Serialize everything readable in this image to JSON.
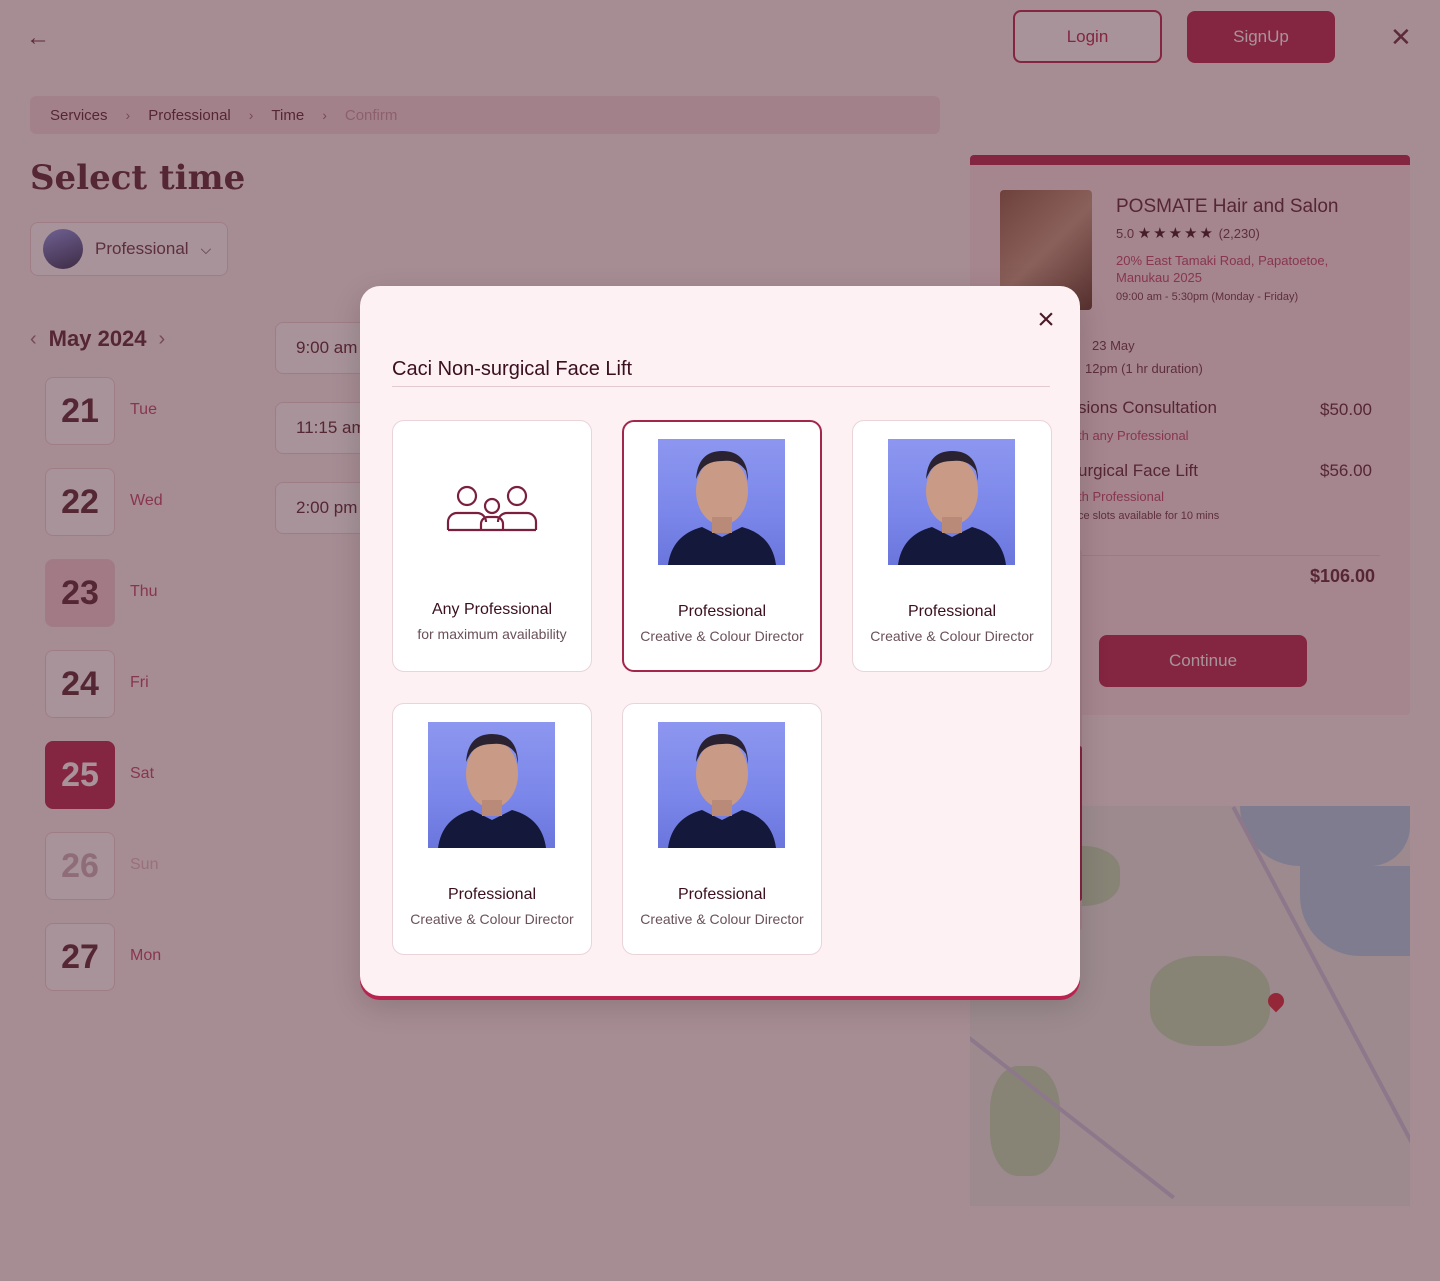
{
  "header": {
    "login_label": "Login",
    "signup_label": "SignUp"
  },
  "breadcrumb": [
    "Services",
    "Professional",
    "Time",
    "Confirm"
  ],
  "page_title": "Select time",
  "professional_select": {
    "label": "Professional"
  },
  "calendar": {
    "month": "May 2024",
    "days": [
      {
        "num": "21",
        "name": "Tue"
      },
      {
        "num": "22",
        "name": "Wed"
      },
      {
        "num": "23",
        "name": "Thu"
      },
      {
        "num": "24",
        "name": "Fri"
      },
      {
        "num": "25",
        "name": "Sat"
      },
      {
        "num": "26",
        "name": "Sun"
      },
      {
        "num": "27",
        "name": "Mon"
      }
    ]
  },
  "time_slots": [
    "9:00 am",
    "11:15 am",
    "2:00 pm"
  ],
  "summary": {
    "salon_name": "POSMATE Hair and Salon",
    "rating": "5.0",
    "review_count": "(2,230)",
    "address": "20% East Tamaki Road, Papatoetoe, Manukau 2025",
    "hours": "09:00 am - 5:30pm (Monday - Friday)",
    "date": "23 May",
    "time": "12pm (1 hr duration)",
    "services": [
      {
        "name": "sions Consultation",
        "with": "th any Professional",
        "price": "$50.00"
      },
      {
        "name": "urgical Face Lift",
        "with": "th Professional",
        "price": "$56.00",
        "note": "ce slots available for 10 mins"
      }
    ],
    "total": "$106.00",
    "continue_label": "Continue"
  },
  "modal": {
    "title": "Caci Non-surgical Face Lift",
    "any": {
      "name": "Any Professional",
      "sub": "for maximum availability"
    },
    "professionals": [
      {
        "name": "Professional",
        "role": "Creative & Colour Director",
        "selected": true
      },
      {
        "name": "Professional",
        "role": "Creative & Colour Director",
        "selected": false
      },
      {
        "name": "Professional",
        "role": "Creative & Colour Director",
        "selected": false
      },
      {
        "name": "Professional",
        "role": "Creative & Colour Director",
        "selected": false
      }
    ]
  },
  "colors": {
    "accent": "#b8234f",
    "selected_border": "#a3264b",
    "modal_bg": "#fdf1f3"
  }
}
